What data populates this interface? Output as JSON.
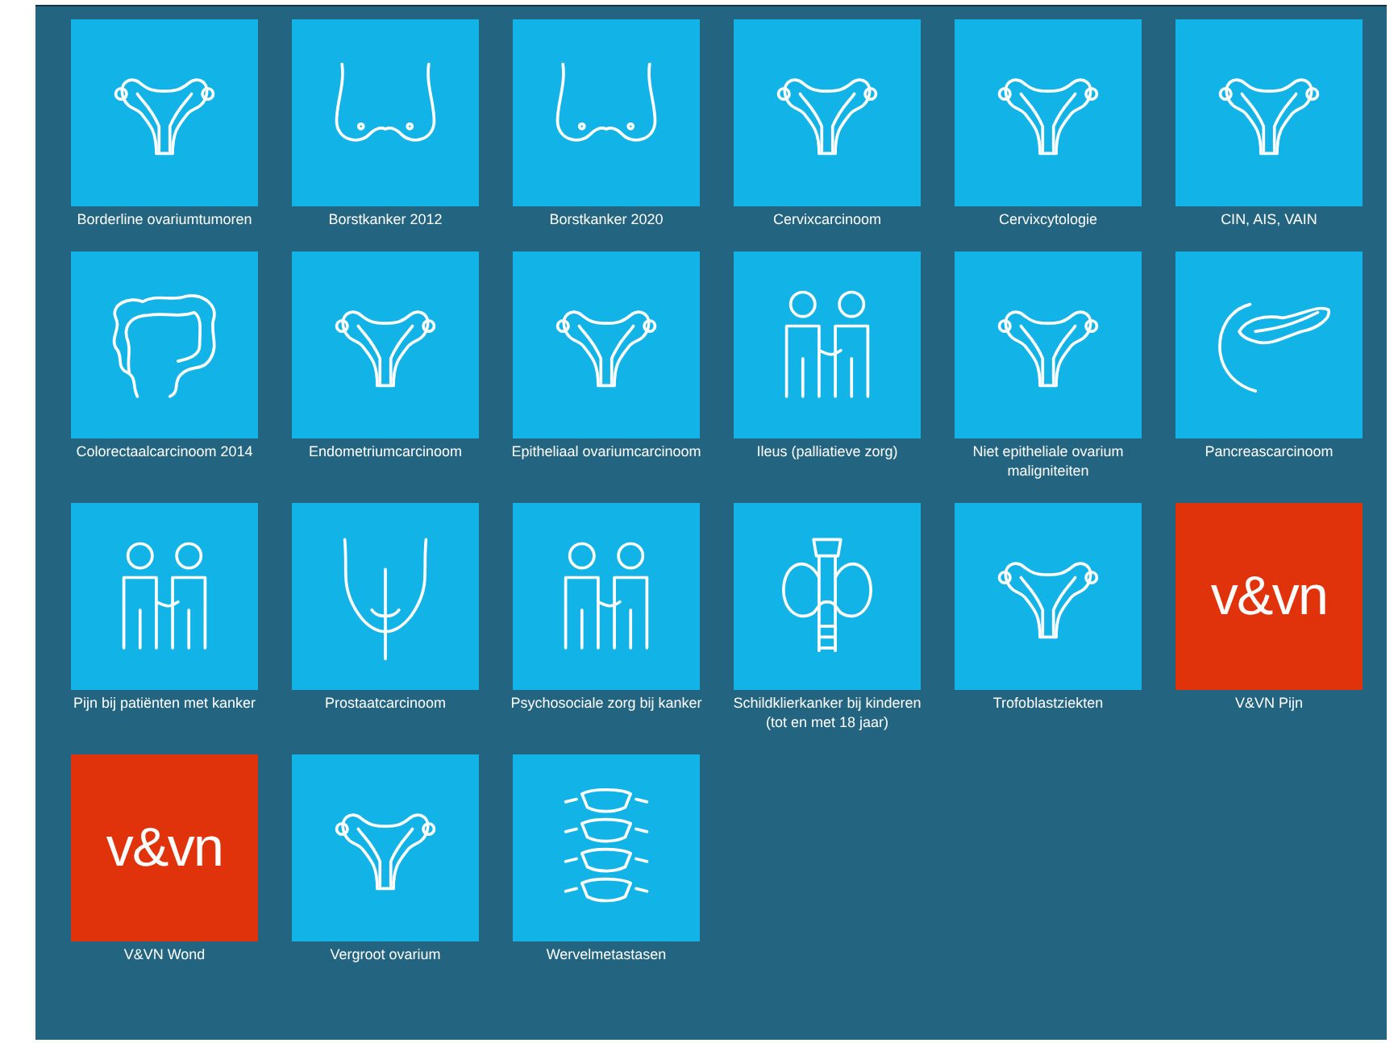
{
  "tiles": [
    {
      "label": "Borderline ovariumtumoren",
      "kind": "uterus"
    },
    {
      "label": "Borstkanker 2012",
      "kind": "breasts"
    },
    {
      "label": "Borstkanker 2020",
      "kind": "breasts"
    },
    {
      "label": "Cervixcarcinoom",
      "kind": "uterus"
    },
    {
      "label": "Cervixcytologie",
      "kind": "uterus"
    },
    {
      "label": "CIN, AIS, VAIN",
      "kind": "uterus"
    },
    {
      "label": "Colorectaalcarcinoom 2014",
      "kind": "colon"
    },
    {
      "label": "Endometriumcarcinoom",
      "kind": "uterus"
    },
    {
      "label": "Epitheliaal ovariumcarcinoom",
      "kind": "uterus"
    },
    {
      "label": "Ileus (palliatieve zorg)",
      "kind": "people"
    },
    {
      "label": "Niet epitheliale ovarium maligniteiten",
      "kind": "uterus"
    },
    {
      "label": "Pancreascarcinoom",
      "kind": "pancreas"
    },
    {
      "label": "Pijn bij patiënten met kanker",
      "kind": "people"
    },
    {
      "label": "Prostaatcarcinoom",
      "kind": "prostate"
    },
    {
      "label": "Psychosociale zorg bij kanker",
      "kind": "people"
    },
    {
      "label": "Schildklierkanker bij kinderen (tot en met 18 jaar)",
      "kind": "thyroid"
    },
    {
      "label": "Trofoblastziekten",
      "kind": "uterus"
    },
    {
      "label": "V&VN Pijn",
      "kind": "logo",
      "logo_text": "v&vn"
    },
    {
      "label": "V&VN Wond",
      "kind": "logo",
      "logo_text": "v&vn"
    },
    {
      "label": "Vergroot ovarium",
      "kind": "uterus"
    },
    {
      "label": "Wervelmetastasen",
      "kind": "spine"
    }
  ]
}
